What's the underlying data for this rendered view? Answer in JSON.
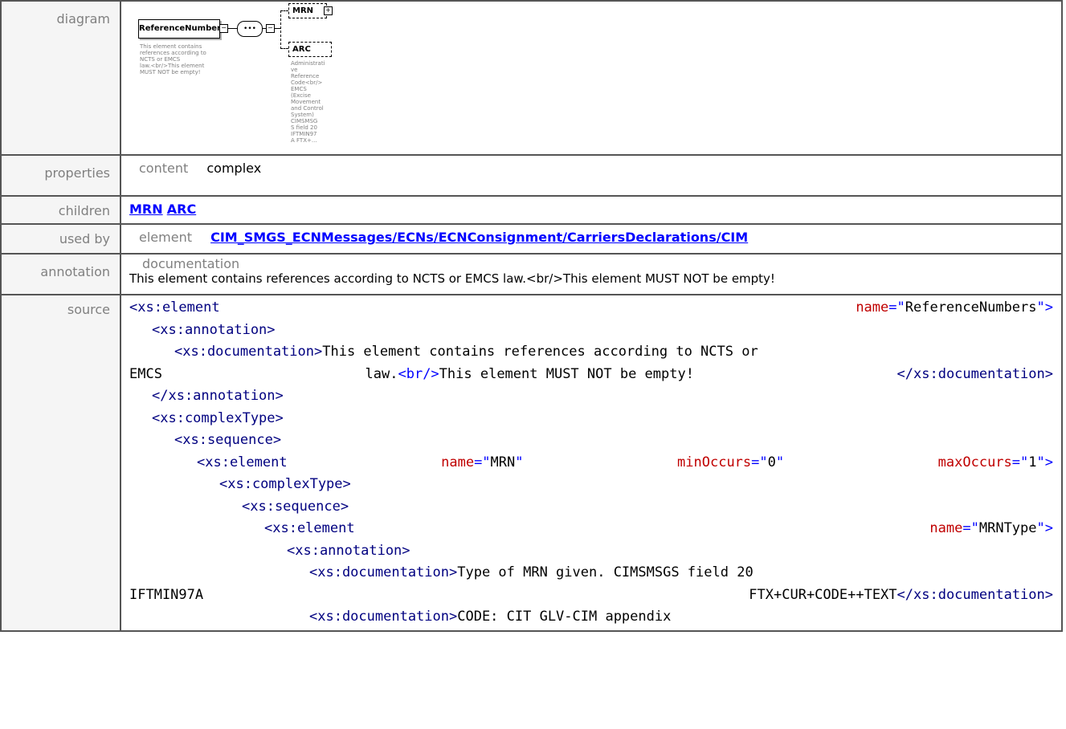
{
  "labels": {
    "diagram": "diagram",
    "properties": "properties",
    "children": "children",
    "used_by": "used by",
    "annotation": "annotation",
    "source": "source"
  },
  "diagram": {
    "root_name": "ReferenceNumbers",
    "root_desc": [
      "This element contains",
      "references according to",
      "NCTS or EMCS",
      "law.<br/>This element",
      "MUST NOT be empty!"
    ],
    "child1": "MRN",
    "child2": "ARC",
    "child2_desc": [
      "Administrati",
      "ve",
      "Reference",
      "Code<br/>",
      "EMCS",
      "(Excise",
      "Movement",
      "and Control",
      "System)",
      "CIMSMSG",
      "S field 20",
      "IFTMIN97",
      "A FTX+..."
    ],
    "seq_symbol": "•••",
    "plus": "+",
    "minus": "−"
  },
  "properties": {
    "key": "content",
    "value": "complex"
  },
  "children": [
    "MRN",
    "ARC"
  ],
  "used_by": {
    "key": "element",
    "value": "CIM_SMGS_ECNMessages/ECNs/ECNConsignment/CarriersDeclarations/CIM"
  },
  "annotation": {
    "key": "documentation",
    "value": "This element contains references according to NCTS or EMCS law.<br/>This element MUST NOT be empty!"
  },
  "source": {
    "l1a": "<xs:element",
    "l1b": "name",
    "l1c": "=\"",
    "l1d": "ReferenceNumbers",
    "l1e": "\">",
    "l2": "<xs:annotation>",
    "l3a": "<xs:documentation>",
    "l3b": "This element contains references according to NCTS or",
    "l4a": "EMCS",
    "l4b": "law.",
    "l4c": "<br/>",
    "l4d": "This element MUST NOT be empty!",
    "l4e": "</xs:documentation>",
    "l5": "</xs:annotation>",
    "l6": "<xs:complexType>",
    "l7": "<xs:sequence>",
    "l8a": "<xs:element",
    "l8b": "name",
    "l8c": "MRN",
    "l8d": "minOccurs",
    "l8e": "0",
    "l8f": "maxOccurs",
    "l8g": "1",
    "l9": "<xs:complexType>",
    "l10": "<xs:sequence>",
    "l11a": "<xs:element",
    "l11b": "name",
    "l11c": "MRNType",
    "l12": "<xs:annotation>",
    "l13a": "<xs:documentation>",
    "l13b": "Type of MRN given. CIMSMSGS field 20",
    "l14a": "IFTMIN97A",
    "l14b": "FTX+CUR+CODE++TEXT",
    "l14c": "</xs:documentation>",
    "l15a": "<xs:documentation>",
    "l15b": "CODE: CIT GLV-CIM appendix"
  }
}
